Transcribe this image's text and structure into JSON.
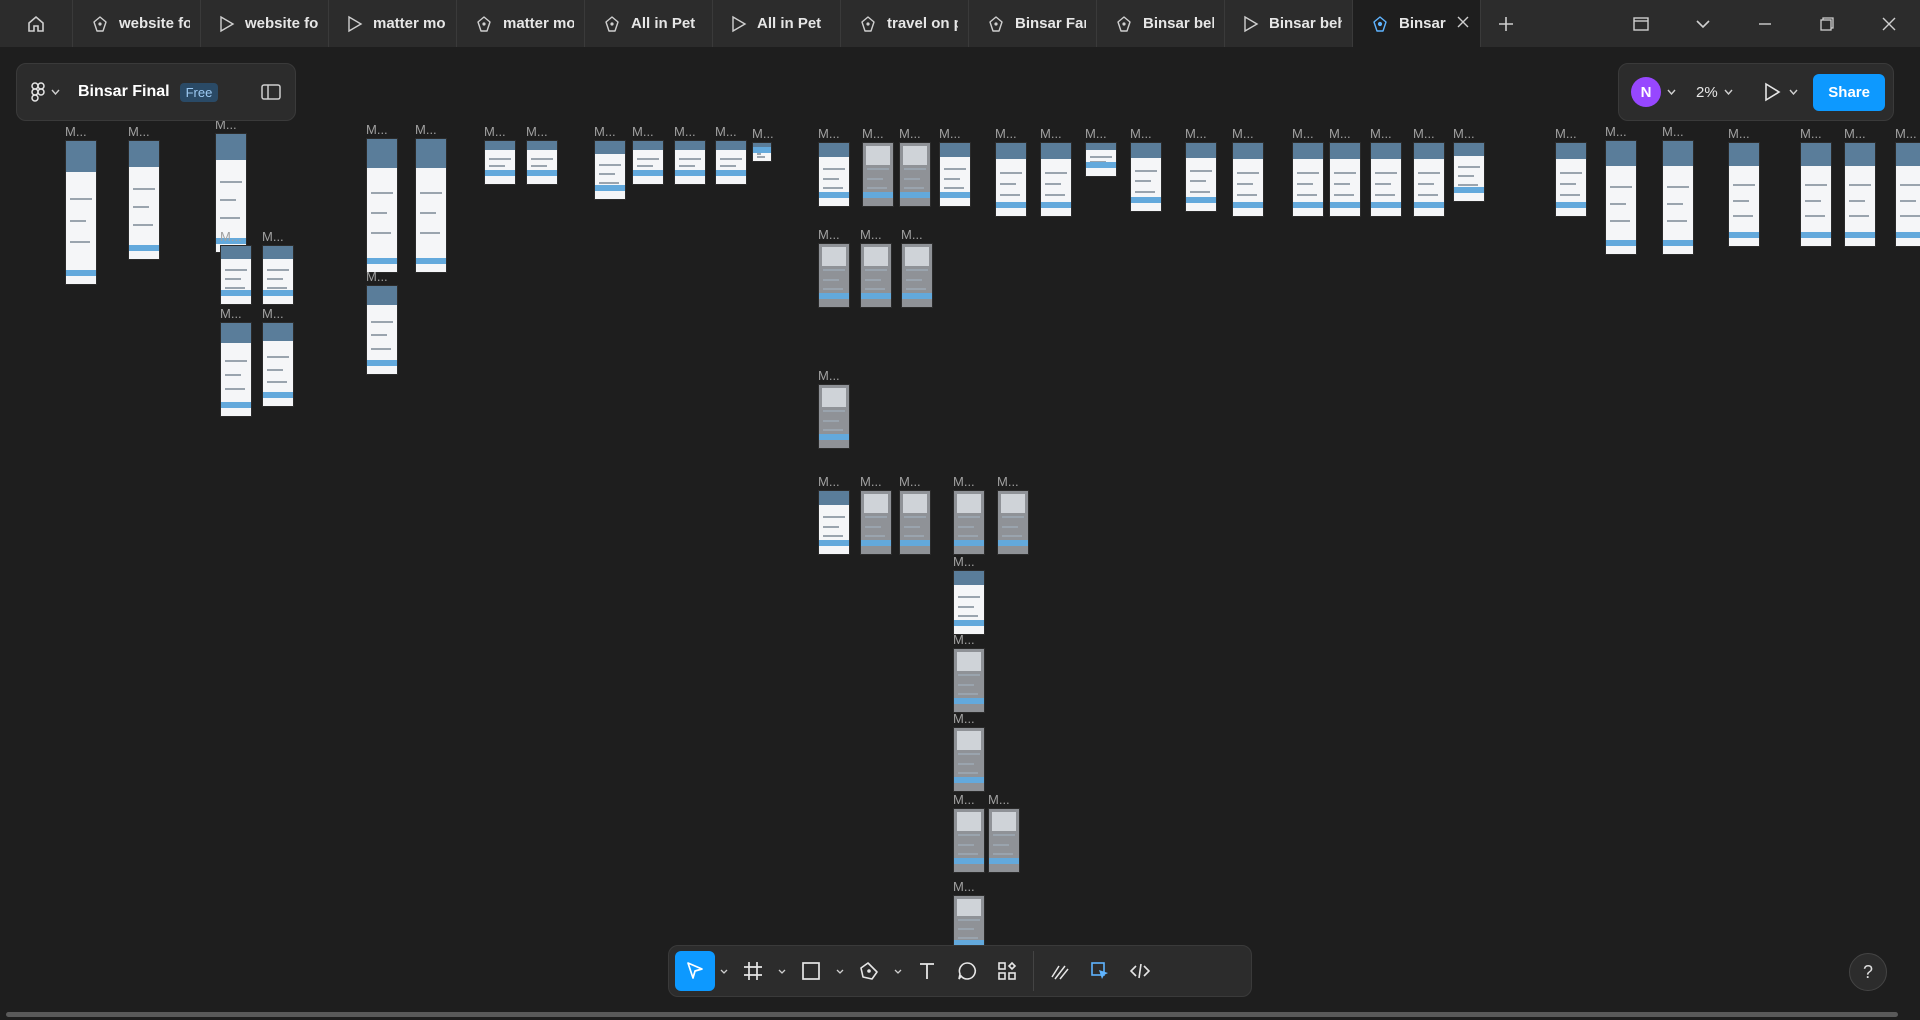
{
  "tabs": [
    {
      "label": "website fo",
      "icon": "figma-design-icon"
    },
    {
      "label": "website fo",
      "icon": "play-icon"
    },
    {
      "label": "matter mo",
      "icon": "play-icon"
    },
    {
      "label": "matter mo",
      "icon": "figma-design-icon"
    },
    {
      "label": "All in Pet",
      "icon": "figma-design-icon"
    },
    {
      "label": "All in Pet",
      "icon": "play-icon"
    },
    {
      "label": "travel on p",
      "icon": "figma-design-icon"
    },
    {
      "label": "Binsar Far",
      "icon": "figma-design-icon"
    },
    {
      "label": "Binsar beh",
      "icon": "figma-design-icon"
    },
    {
      "label": "Binsar beh",
      "icon": "play-icon"
    },
    {
      "label": "Binsar",
      "icon": "figma-design-icon",
      "active": true
    }
  ],
  "file": {
    "name": "Binsar Final",
    "plan": "Free"
  },
  "header_right": {
    "avatar_initial": "N",
    "zoom": "2%",
    "share_label": "Share"
  },
  "canvas": {
    "frame_label": "M..."
  },
  "help_label": "?",
  "colors": {
    "accent": "#0d99ff",
    "avatar": "#9747ff",
    "canvas": "#1e1e1e",
    "panel": "#2c2c2c"
  }
}
